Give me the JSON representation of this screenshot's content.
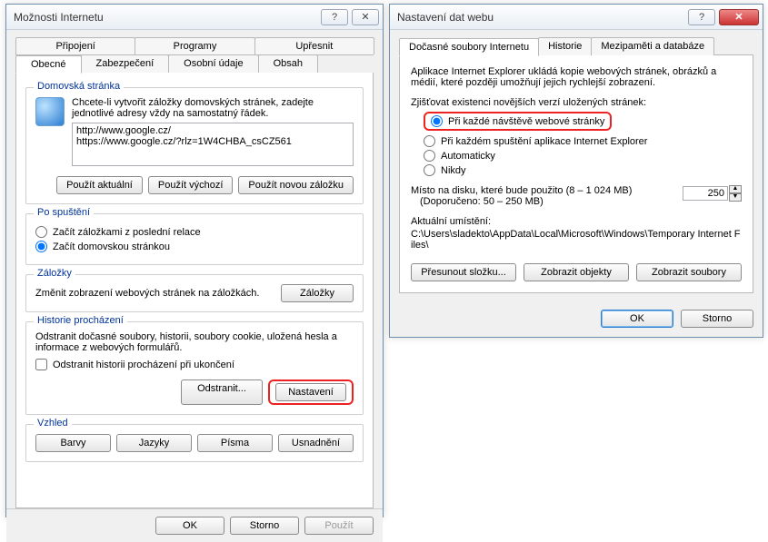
{
  "left": {
    "title": "Možnosti Internetu",
    "tabs1": [
      "Připojení",
      "Programy",
      "Upřesnit"
    ],
    "tabs2": [
      "Obecné",
      "Zabezpečení",
      "Osobní údaje",
      "Obsah"
    ],
    "home": {
      "title": "Domovská stránka",
      "hint": "Chcete-li vytvořit záložky domovských stránek, zadejte jednotlivé adresy vždy na samostatný řádek.",
      "urls": "http://www.google.cz/\nhttps://www.google.cz/?rlz=1W4CHBA_csCZ561",
      "btn_current": "Použít aktuální",
      "btn_default": "Použít výchozí",
      "btn_newtab": "Použít novou záložku"
    },
    "startup": {
      "title": "Po spuštění",
      "opt_tabs": "Začít záložkami z poslední relace",
      "opt_home": "Začít domovskou stránkou"
    },
    "tabs_group": {
      "title": "Záložky",
      "text": "Změnit zobrazení webových stránek na záložkách.",
      "btn": "Záložky"
    },
    "history": {
      "title": "Historie procházení",
      "text": "Odstranit dočasné soubory, historii, soubory cookie, uložená hesla a informace z webových formulářů.",
      "chk": "Odstranit historii procházení při ukončení",
      "btn_delete": "Odstranit...",
      "btn_settings": "Nastavení"
    },
    "appearance": {
      "title": "Vzhled",
      "btn_colors": "Barvy",
      "btn_langs": "Jazyky",
      "btn_fonts": "Písma",
      "btn_access": "Usnadnění"
    },
    "buttons": {
      "ok": "OK",
      "cancel": "Storno",
      "apply": "Použít"
    }
  },
  "right": {
    "title": "Nastavení dat webu",
    "tabs": [
      "Dočasné soubory Internetu",
      "Historie",
      "Mezipaměti a databáze"
    ],
    "desc": "Aplikace Internet Explorer ukládá kopie webových stránek, obrázků a médií, které později umožňují jejich rychlejší zobrazení.",
    "check_label": "Zjišťovat existenci novějších verzí uložených stránek:",
    "opts": {
      "every_visit": "Při každé návštěvě webové stránky",
      "every_start": "Při každém spuštění aplikace Internet Explorer",
      "auto": "Automaticky",
      "never": "Nikdy"
    },
    "disk_label": "Místo na disku, které bude použito (8 – 1 024 MB)",
    "disk_hint": "(Doporučeno: 50 – 250 MB)",
    "disk_value": "250",
    "loc_label": "Aktuální umístění:",
    "loc_path": "C:\\Users\\sladekto\\AppData\\Local\\Microsoft\\Windows\\Temporary Internet Files\\",
    "btn_move": "Přesunout složku...",
    "btn_objects": "Zobrazit objekty",
    "btn_files": "Zobrazit soubory",
    "ok": "OK",
    "cancel": "Storno"
  }
}
